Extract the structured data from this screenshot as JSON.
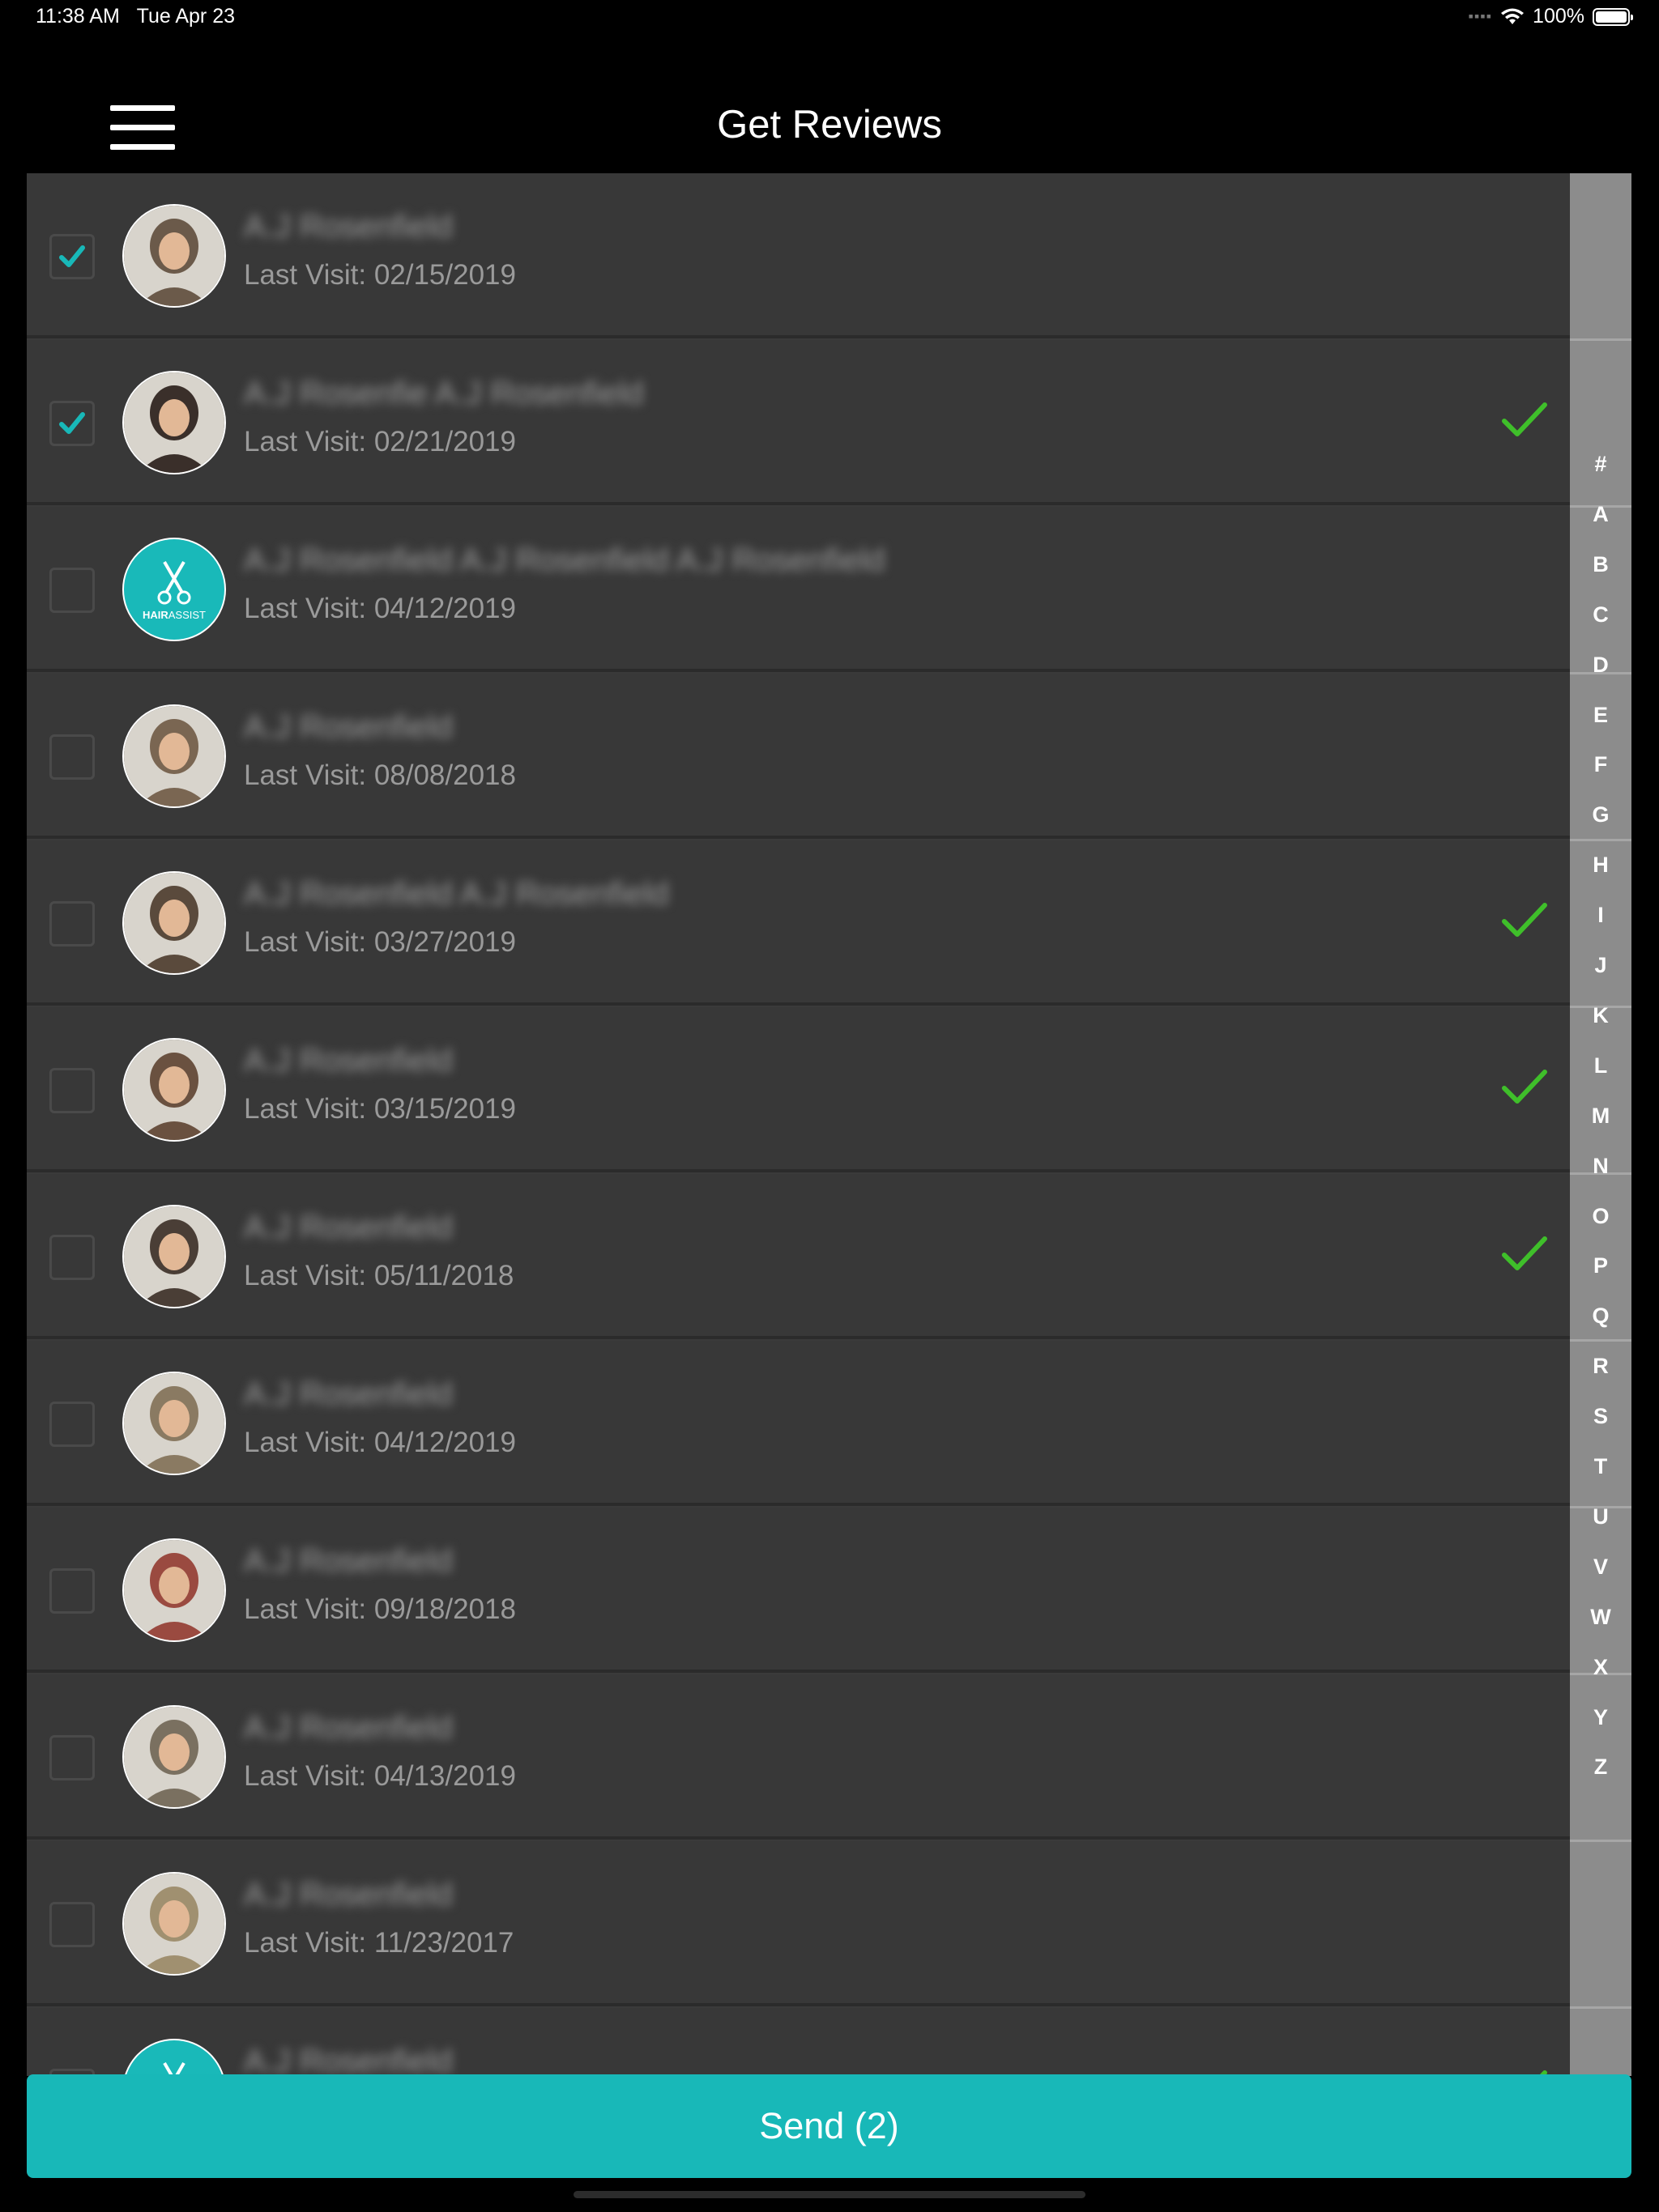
{
  "status_bar": {
    "time": "11:38 AM",
    "date": "Tue Apr 23",
    "battery": "100%"
  },
  "header": {
    "title": "Get Reviews"
  },
  "customers": [
    {
      "name": "A.J Rosenfield",
      "last_visit": "Last Visit: 02/15/2019",
      "selected": true,
      "reviewed": false,
      "avatar": "photo"
    },
    {
      "name": "A.J Rosenfie A.J Rosenfield",
      "last_visit": "Last Visit: 02/21/2019",
      "selected": true,
      "reviewed": true,
      "avatar": "photo"
    },
    {
      "name": "A.J Rosenfield A.J Rosenfield A.J Rosenfield",
      "last_visit": "Last Visit: 04/12/2019",
      "selected": false,
      "reviewed": false,
      "avatar": "hairassist-logo"
    },
    {
      "name": "A.J Rosenfield",
      "last_visit": "Last Visit: 08/08/2018",
      "selected": false,
      "reviewed": false,
      "avatar": "photo"
    },
    {
      "name": "A.J Rosenfield A.J Rosenfield",
      "last_visit": "Last Visit: 03/27/2019",
      "selected": false,
      "reviewed": true,
      "avatar": "photo"
    },
    {
      "name": "A.J Rosenfield",
      "last_visit": "Last Visit: 03/15/2019",
      "selected": false,
      "reviewed": true,
      "avatar": "photo"
    },
    {
      "name": "A.J Rosenfield",
      "last_visit": "Last Visit: 05/11/2018",
      "selected": false,
      "reviewed": true,
      "avatar": "photo"
    },
    {
      "name": "A.J Rosenfield",
      "last_visit": "Last Visit: 04/12/2019",
      "selected": false,
      "reviewed": false,
      "avatar": "photo"
    },
    {
      "name": "A.J Rosenfield",
      "last_visit": "Last Visit: 09/18/2018",
      "selected": false,
      "reviewed": false,
      "avatar": "photo"
    },
    {
      "name": "A.J Rosenfield",
      "last_visit": "Last Visit: 04/13/2019",
      "selected": false,
      "reviewed": false,
      "avatar": "photo"
    },
    {
      "name": "A.J Rosenfield",
      "last_visit": "Last Visit: 11/23/2017",
      "selected": false,
      "reviewed": false,
      "avatar": "photo"
    },
    {
      "name": "A.J Rosenfield",
      "last_visit": "",
      "selected": false,
      "reviewed": true,
      "avatar": "hairassist-logo"
    }
  ],
  "logo_text": {
    "hair": "HAIR",
    "assist": "ASSIST"
  },
  "index_letters": [
    "#",
    "A",
    "B",
    "C",
    "D",
    "E",
    "F",
    "G",
    "H",
    "I",
    "J",
    "K",
    "L",
    "M",
    "N",
    "O",
    "P",
    "Q",
    "R",
    "S",
    "T",
    "U",
    "V",
    "W",
    "X",
    "Y",
    "Z"
  ],
  "send_button": {
    "label": "Send (2)"
  },
  "colors": {
    "accent": "#18b8b8",
    "check": "#3fbf2a",
    "row_bg": "#383838",
    "index_bg": "#8c8c8c"
  },
  "icons": {
    "menu": "hamburger-menu-icon",
    "wifi": "wifi-icon",
    "battery": "battery-icon",
    "signal": "signal-dots-icon",
    "reviewed": "green-checkmark-icon",
    "checkbox": "checkbox-icon"
  }
}
